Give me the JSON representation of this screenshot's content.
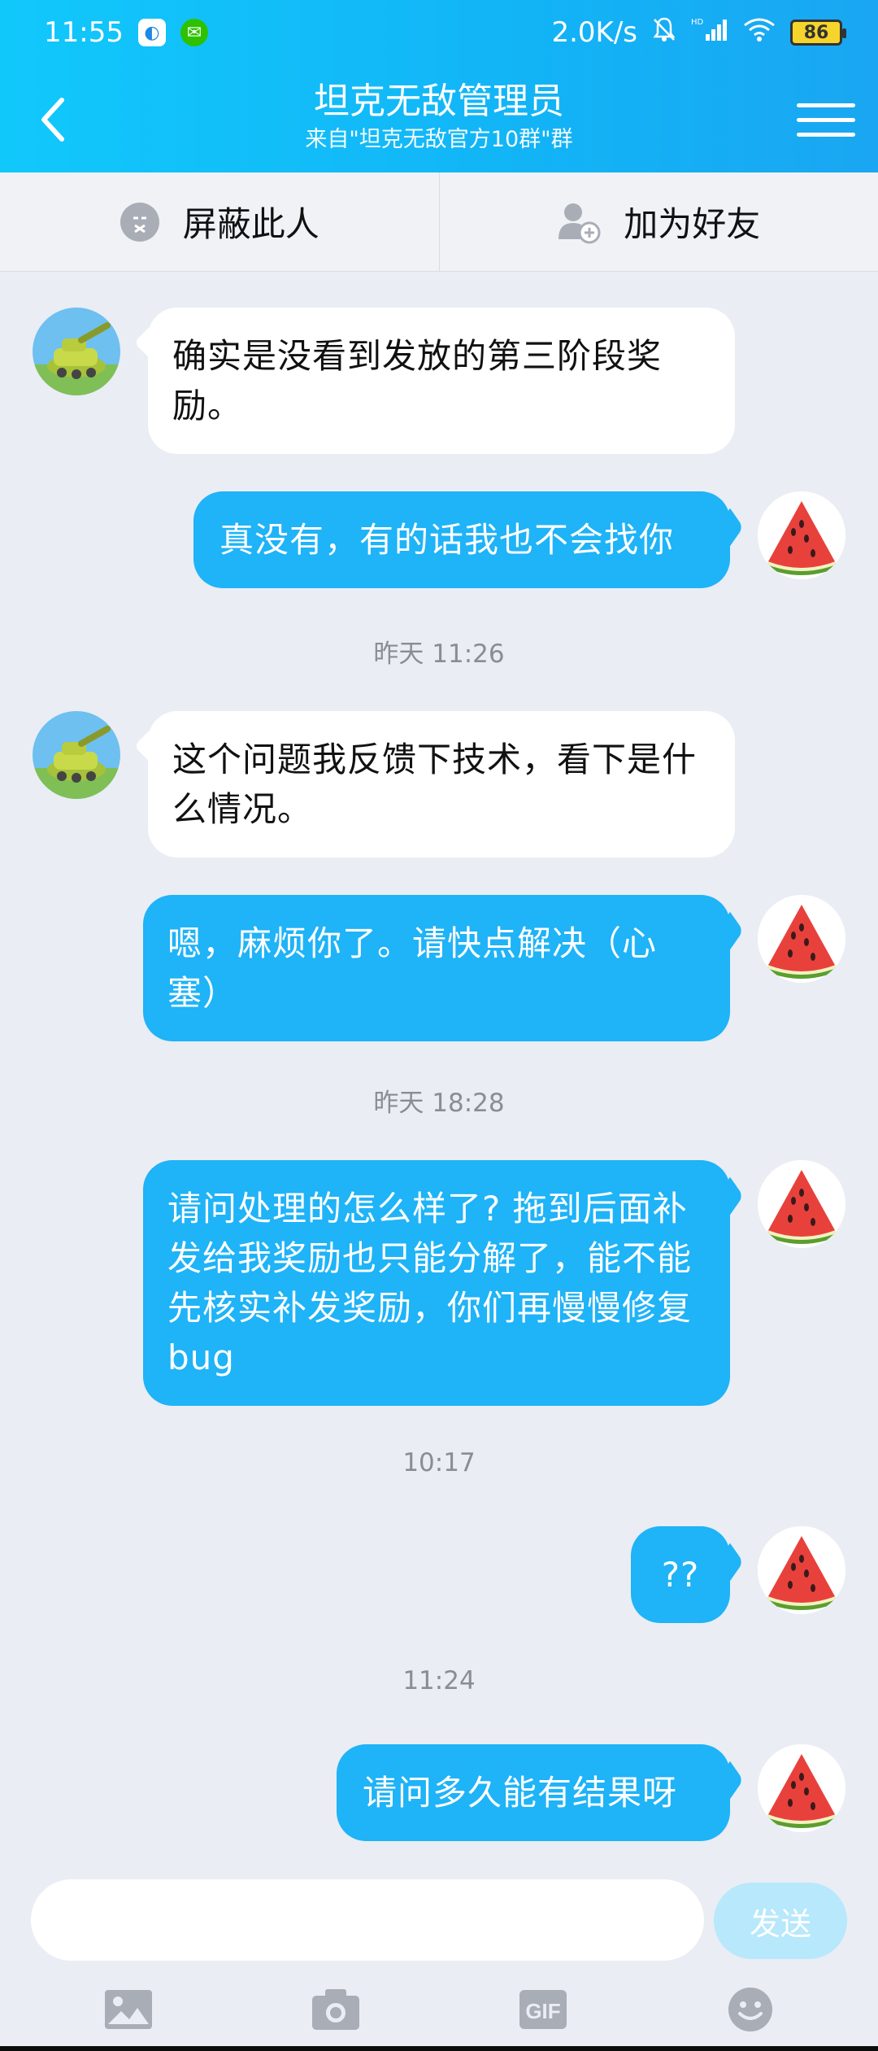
{
  "status_bar": {
    "time": "11:55",
    "speed": "2.0K/s",
    "hd": "HD",
    "battery": "86"
  },
  "nav": {
    "title": "坦克无敌管理员",
    "subtitle": "来自\"坦克无敌官方10群\"群"
  },
  "actions": {
    "block_label": "屏蔽此人",
    "add_friend_label": "加为好友"
  },
  "messages": [
    {
      "text": "确实是没看到发放的第三阶段奖励。"
    },
    {
      "text": "真没有，有的话我也不会找你"
    },
    {
      "text": "这个问题我反馈下技术，看下是什么情况。"
    },
    {
      "text": "嗯，麻烦你了。请快点解决（心塞）"
    },
    {
      "text": "请问处理的怎么样了? 拖到后面补发给我奖励也只能分解了，能不能先核实补发奖励，你们再慢慢修复bug"
    },
    {
      "text": "??"
    },
    {
      "text": "请问多久能有结果呀"
    }
  ],
  "timestamps": [
    "昨天 11:26",
    "昨天 18:28",
    "10:17",
    "11:24"
  ],
  "input": {
    "placeholder": "",
    "send_label": "发送"
  },
  "toolbar": {
    "gif_label": "GIF"
  },
  "colors": {
    "header": "#12b4f6",
    "bubble_out": "#1fb3f7",
    "bubble_in": "#ffffff",
    "background": "#eaedf4"
  }
}
